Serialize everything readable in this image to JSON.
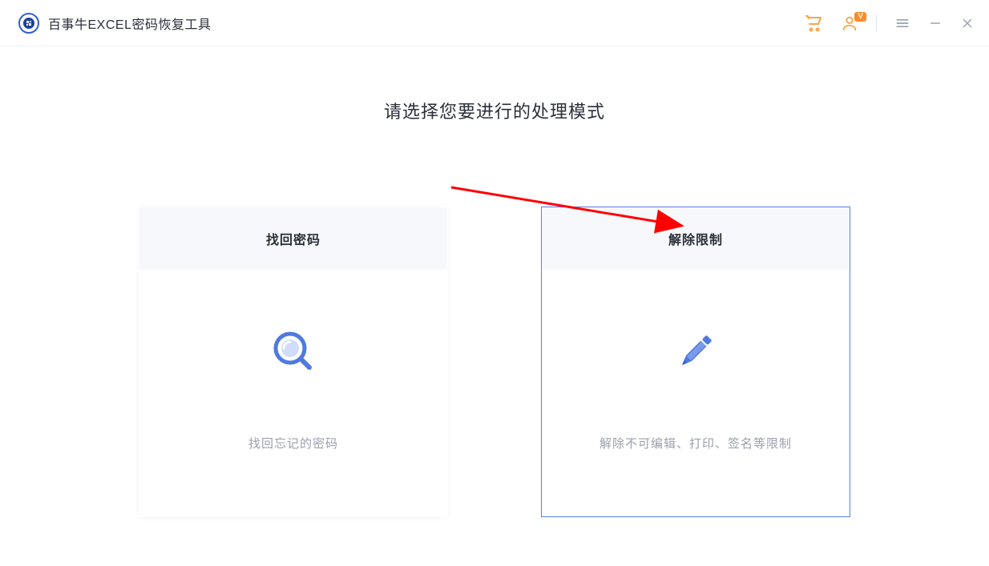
{
  "header": {
    "app_title": "百事牛EXCEL密码恢复工具",
    "vip_badge": "V",
    "icons": {
      "cart": "cart-icon",
      "account": "account-icon",
      "menu": "hamburger-icon",
      "minimize": "minimize-icon",
      "close": "close-icon"
    }
  },
  "main": {
    "heading": "请选择您要进行的处理模式",
    "cards": [
      {
        "title": "找回密码",
        "desc": "找回忘记的密码",
        "icon": "search-icon",
        "selected": false
      },
      {
        "title": "解除限制",
        "desc": "解除不可编辑、打印、签名等限制",
        "icon": "pencil-icon",
        "selected": true
      }
    ]
  },
  "colors": {
    "accent_orange": "#f6a44c",
    "accent_blue": "#5b7de8",
    "icon_blue": "#4f7ae0"
  }
}
